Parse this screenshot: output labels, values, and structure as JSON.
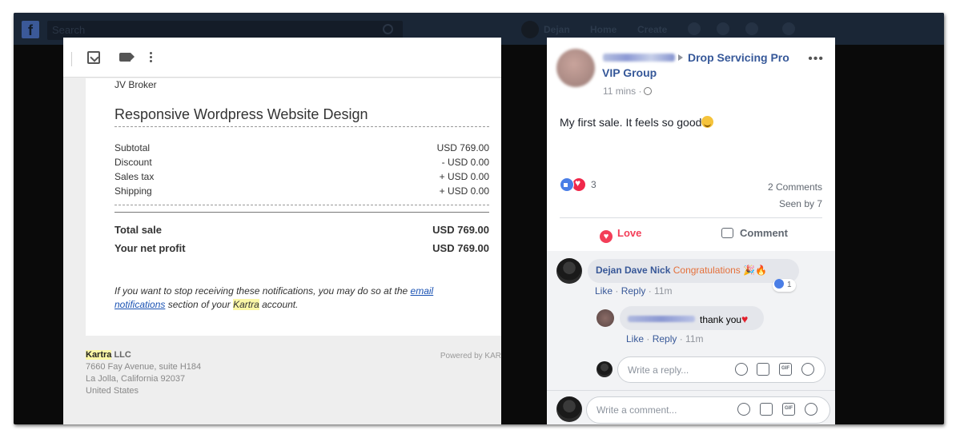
{
  "fb_bar": {
    "search_placeholder": "Search",
    "user_name": "Dejan",
    "nav_home": "Home",
    "nav_create": "Create"
  },
  "email": {
    "toolbar": {
      "archive_icon": "archive-icon",
      "label_icon": "label-icon",
      "more_icon": "more-vert-icon"
    },
    "role": "JV Broker",
    "product": "Responsive Wordpress Website Design",
    "lines": [
      {
        "label": "Subtotal",
        "value": "USD 769.00"
      },
      {
        "label": "Discount",
        "value": "- USD 0.00"
      },
      {
        "label": "Sales tax",
        "value": "+ USD 0.00"
      },
      {
        "label": "Shipping",
        "value": "+ USD 0.00"
      }
    ],
    "total_label": "Total sale",
    "total_value": "USD 769.00",
    "profit_label": "Your net profit",
    "profit_value": "USD 769.00",
    "note_before": "If you want to stop receiving these notifications, you may do so at the ",
    "note_link": "email notifications",
    "note_mid": " section of your ",
    "note_brand": "Kartra",
    "note_after": " account.",
    "footer": {
      "brand": "Kartra",
      "company_suffix": " LLC",
      "address1": "7660 Fay Avenue, suite H184",
      "address2": "La Jolla, California 92037",
      "country": "United States",
      "powered": "Powered by KAR"
    }
  },
  "post": {
    "group_name": "Drop Servicing Pro VIP Group",
    "time": "11 mins ·",
    "more": "•••",
    "text": "My first sale. It feels so good",
    "reaction_count": "3",
    "comments_count": "2 Comments",
    "seen_by": "Seen by 7",
    "love_label": "Love",
    "comment_label": "Comment",
    "comment1": {
      "author": "Dejan Dave Nick",
      "text": "Congratulations",
      "emoji": "🎉🔥",
      "likes": "1",
      "like": "Like",
      "reply": "Reply",
      "time": "11m"
    },
    "comment2": {
      "text": "thank you",
      "emoji": "♥",
      "like": "Like",
      "reply": "Reply",
      "time": "11m"
    },
    "reply_placeholder": "Write a reply...",
    "comment_placeholder": "Write a comment...",
    "input_icons": [
      "emoji-icon",
      "camera-icon",
      "gif-icon",
      "sticker-icon"
    ],
    "gif_label": "GIF",
    "colors": {
      "link": "#365899",
      "love": "#f33e58",
      "like": "#4a7ee6"
    }
  }
}
